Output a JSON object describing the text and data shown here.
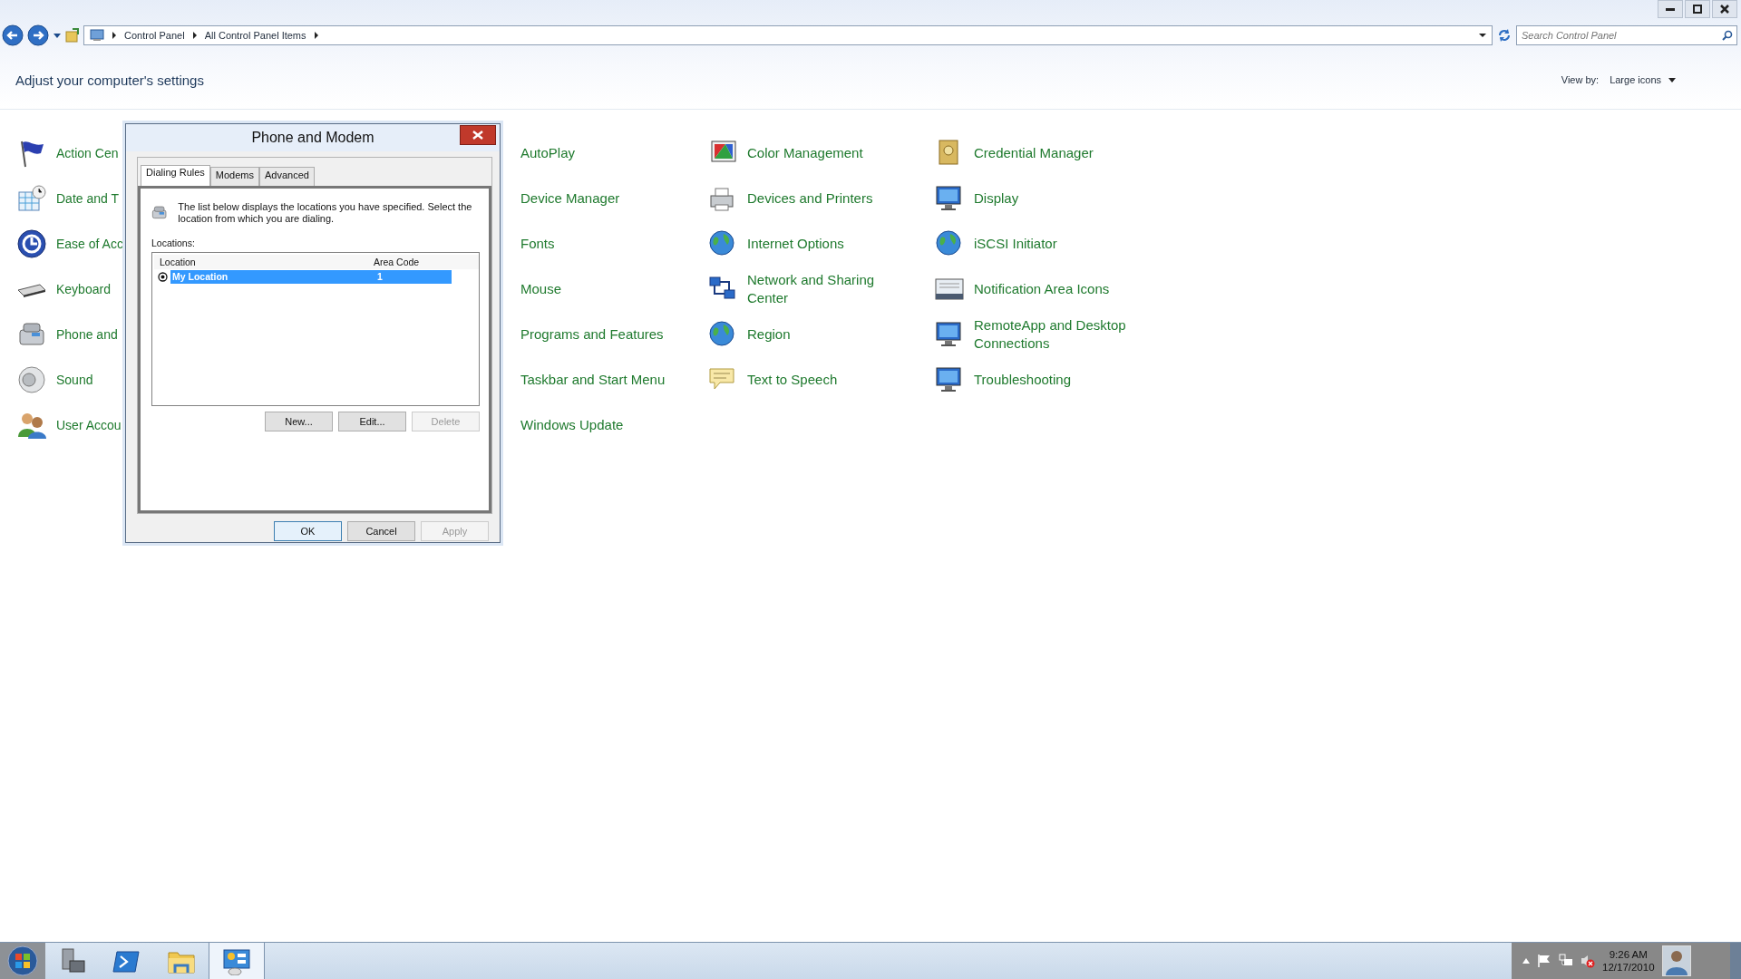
{
  "address_bar": {
    "breadcrumb": [
      "Control Panel",
      "All Control Panel Items"
    ]
  },
  "search": {
    "placeholder": "Search Control Panel"
  },
  "header": {
    "title": "Adjust your computer's settings",
    "view_by_label": "View by:",
    "view_by_value": "Large icons"
  },
  "columns": [
    {
      "items": [
        "Action Cen",
        "Date and T",
        "Ease of Acc",
        "Keyboard",
        "Phone and",
        "Sound",
        "User Accou"
      ]
    },
    {
      "items": [
        "AutoPlay",
        "Device Manager",
        "Fonts",
        "Mouse",
        "Programs and Features",
        "Taskbar and Start Menu",
        "Windows Update"
      ]
    },
    {
      "items": [
        "Color Management",
        "Devices and Printers",
        "Internet Options",
        "Network and Sharing Center",
        "Region",
        "Text to Speech"
      ]
    },
    {
      "items": [
        "Credential Manager",
        "Display",
        "iSCSI Initiator",
        "Notification Area Icons",
        "RemoteApp and Desktop Connections",
        "Troubleshooting"
      ]
    }
  ],
  "dialog": {
    "title": "Phone and Modem",
    "tabs": [
      {
        "label": "Dialing Rules",
        "selected": true
      },
      {
        "label": "Modems",
        "selected": false
      },
      {
        "label": "Advanced",
        "selected": false
      }
    ],
    "description": "The list below displays the locations you have specified. Select the location from which you are dialing.",
    "locations_label": "Locations:",
    "list_columns": [
      "Location",
      "Area Code"
    ],
    "rows": [
      {
        "location": "My Location",
        "area_code": "1",
        "selected": true,
        "default": true
      }
    ],
    "list_buttons": [
      {
        "label": "New...",
        "disabled": false
      },
      {
        "label": "Edit...",
        "disabled": false
      },
      {
        "label": "Delete",
        "disabled": true
      }
    ],
    "footer_buttons": [
      {
        "label": "OK",
        "disabled": false,
        "default": true
      },
      {
        "label": "Cancel",
        "disabled": false,
        "default": false
      },
      {
        "label": "Apply",
        "disabled": true,
        "default": false
      }
    ]
  },
  "taskbar": {
    "apps": [
      {
        "active": false
      },
      {
        "active": false
      },
      {
        "active": false
      },
      {
        "active": true
      }
    ],
    "time": "9:26 AM",
    "date": "12/17/2010"
  }
}
